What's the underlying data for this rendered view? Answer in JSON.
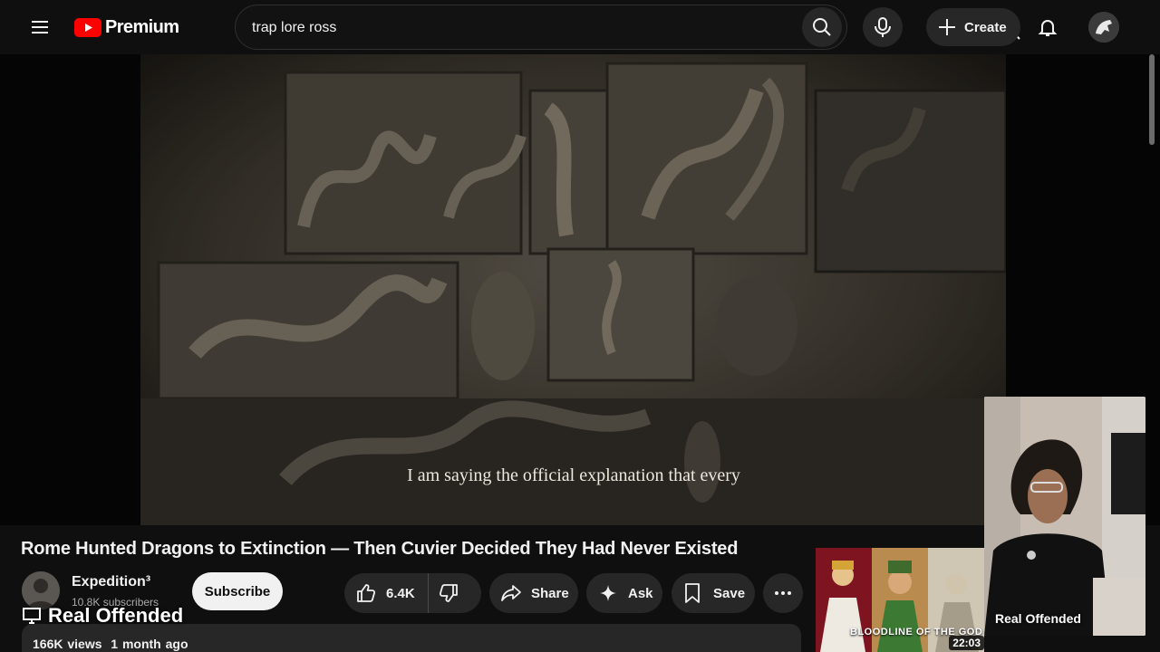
{
  "header": {
    "logo_text": "Premium",
    "search": {
      "value": "trap lore ross"
    },
    "create_label": "Create"
  },
  "player": {
    "caption": "I am saying the official explanation that every"
  },
  "video": {
    "title": "Rome Hunted Dragons to Extinction — Then Cuvier Decided They Had Never Existed",
    "channel_name": "Expedition³",
    "subscribers": "10.8K subscribers",
    "subscribe_label": "Subscribe",
    "likes": "6.4K",
    "share_label": "Share",
    "ask_label": "Ask",
    "save_label": "Save",
    "views": "166K views",
    "age": "1 month ago"
  },
  "overlay": {
    "label": "Real Offended"
  },
  "suggested": {
    "thumbnail_caption": "BLOODLINE OF THE GOD",
    "duration": "22:03"
  },
  "webcam": {
    "label": "Real Offended"
  },
  "colors": {
    "brand_red": "#ff0000",
    "background": "#0f0f0f",
    "pill_bg": "#272727"
  },
  "icons": [
    "menu-icon",
    "youtube-logo-icon",
    "close-icon",
    "search-icon",
    "mic-icon",
    "plus-icon",
    "bell-icon",
    "like-icon",
    "dislike-icon",
    "share-icon",
    "sparkle-icon",
    "bookmark-icon",
    "more-icon",
    "monitor-icon"
  ]
}
